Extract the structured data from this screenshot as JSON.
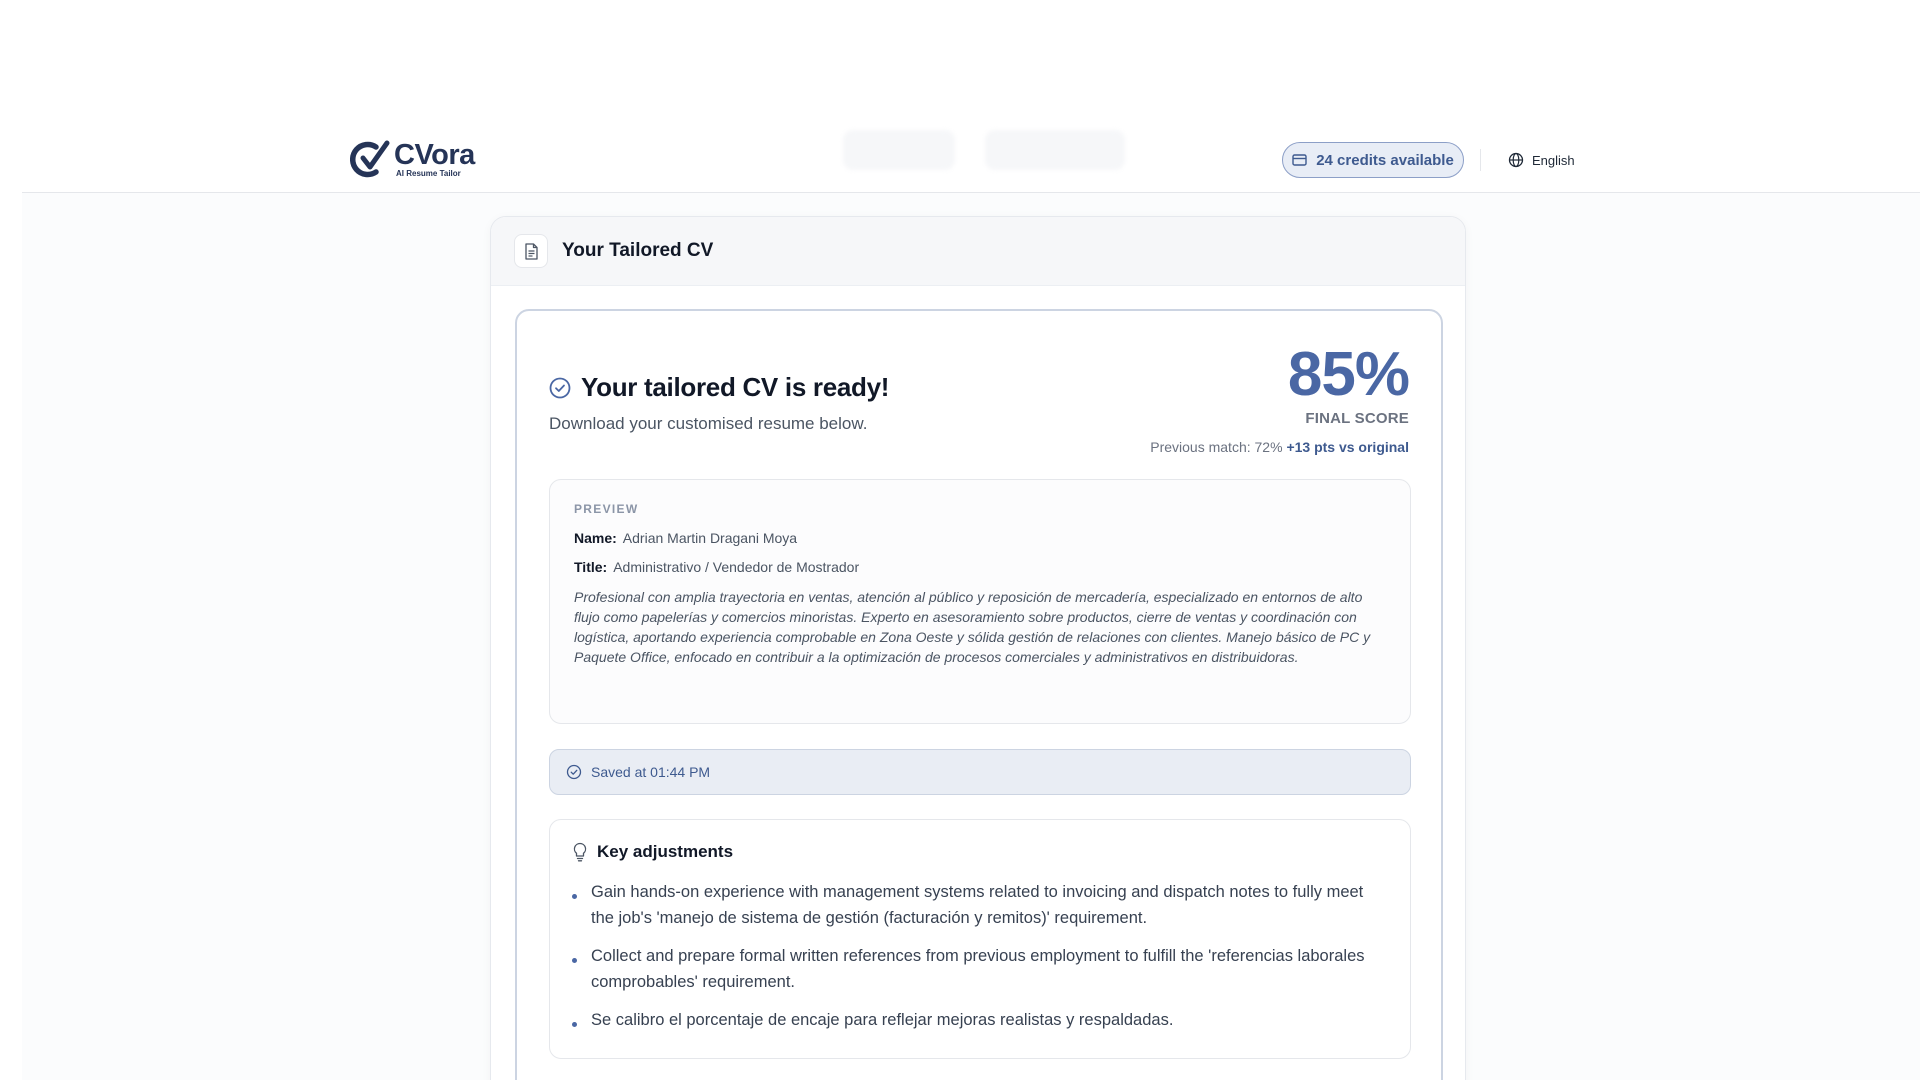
{
  "app": {
    "logo_name": "CVora",
    "logo_tagline": "AI Resume Tailor"
  },
  "header": {
    "credits_label": "24 credits available",
    "language": "English"
  },
  "card": {
    "title": "Your Tailored CV",
    "ready_title": "Your tailored CV is ready!",
    "ready_subtitle": "Download your customised resume below.",
    "score": {
      "value": "85%",
      "label": "FINAL SCORE",
      "previous": "Previous match: 72%",
      "delta": "+13 pts vs original"
    },
    "preview": {
      "label": "PREVIEW",
      "name_key": "Name:",
      "name_value": "Adrian Martin Dragani Moya",
      "title_key": "Title:",
      "title_value": "Administrativo / Vendedor de Mostrador",
      "summary": "Profesional con amplia trayectoria en ventas, atención al público y reposición de mercadería, especializado en entornos de alto flujo como papelerías y comercios minoristas. Experto en asesoramiento sobre productos, cierre de ventas y coordinación con logística, aportando experiencia comprobable en Zona Oeste y sólida gestión de relaciones con clientes. Manejo básico de PC y Paquete Office, enfocado en contribuir a la optimización de procesos comerciales y administrativos en distribuidoras."
    },
    "saved_text": "Saved at 01:44 PM",
    "adjustments": {
      "title": "Key adjustments",
      "items": [
        "Gain hands-on experience with management systems related to invoicing and dispatch notes to fully meet the job's 'manejo de sistema de gestión (facturación y remitos)' requirement.",
        "Collect and prepare formal written references from previous employment to fulfill the 'referencias laborales comprobables' requirement.",
        "Se calibro el porcentaje de encaje para reflejar mejoras realistas y respaldadas."
      ]
    }
  },
  "colors": {
    "accent": "#4a67a4",
    "brand_dark": "#253457",
    "saved_bg": "#e9edf4"
  }
}
